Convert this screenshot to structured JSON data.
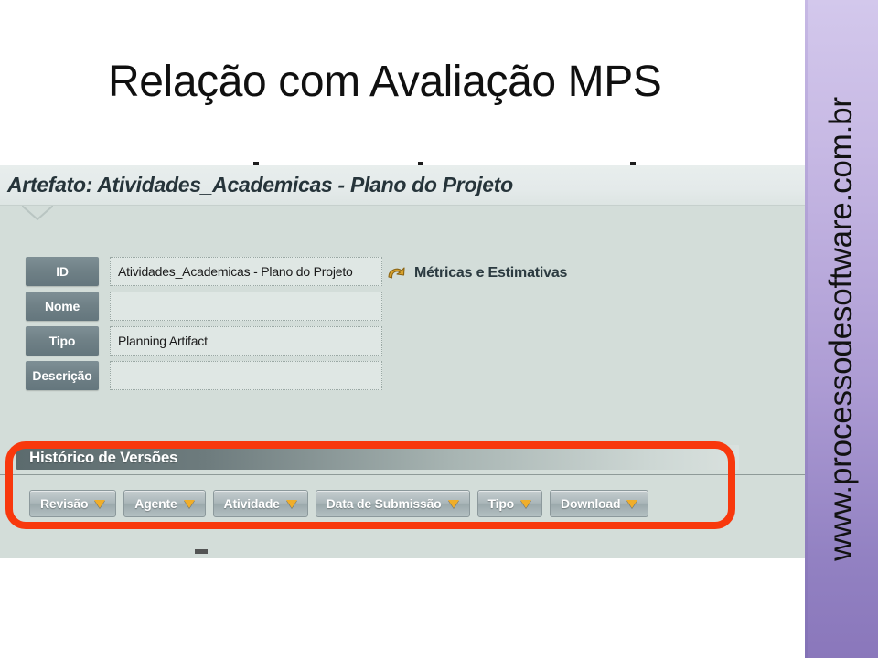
{
  "slide": {
    "title": "Relação com Avaliação MPS",
    "background_color": "#ffffff"
  },
  "side_band": {
    "url_text": "www.processodesoftware.com.br",
    "gradient_top": "#d3c8ec",
    "gradient_bottom": "#8a77bb"
  },
  "ghost_texts": {
    "line1": "",
    "line2": ""
  },
  "app_screenshot": {
    "header": {
      "title": "Artefato: Atividades_Academicas - Plano do Projeto"
    },
    "form": {
      "rows": [
        {
          "label": "ID",
          "value": "Atividades_Academicas - Plano do Projeto"
        },
        {
          "label": "Nome",
          "value": ""
        },
        {
          "label": "Tipo",
          "value": "Planning Artifact"
        },
        {
          "label": "Descrição",
          "value": ""
        }
      ]
    },
    "metrics_link": {
      "icon": "curved-arrow-icon",
      "label": "Métricas e Estimativas"
    },
    "history": {
      "section_title": "Histórico de Versões",
      "columns": [
        {
          "label": "Revisão",
          "sort_icon": "sort-caret-down-icon"
        },
        {
          "label": "Agente",
          "sort_icon": "sort-caret-down-icon"
        },
        {
          "label": "Atividade",
          "sort_icon": "sort-caret-down-icon"
        },
        {
          "label": "Data de Submissão",
          "sort_icon": "sort-caret-down-icon"
        },
        {
          "label": "Tipo",
          "sort_icon": "sort-caret-down-icon"
        },
        {
          "label": "Download",
          "sort_icon": "sort-caret-down-icon"
        }
      ]
    },
    "panel_background": "#d3ddd9"
  },
  "annotation": {
    "highlight_color": "#f8380d",
    "shape": "rounded-rectangle"
  }
}
